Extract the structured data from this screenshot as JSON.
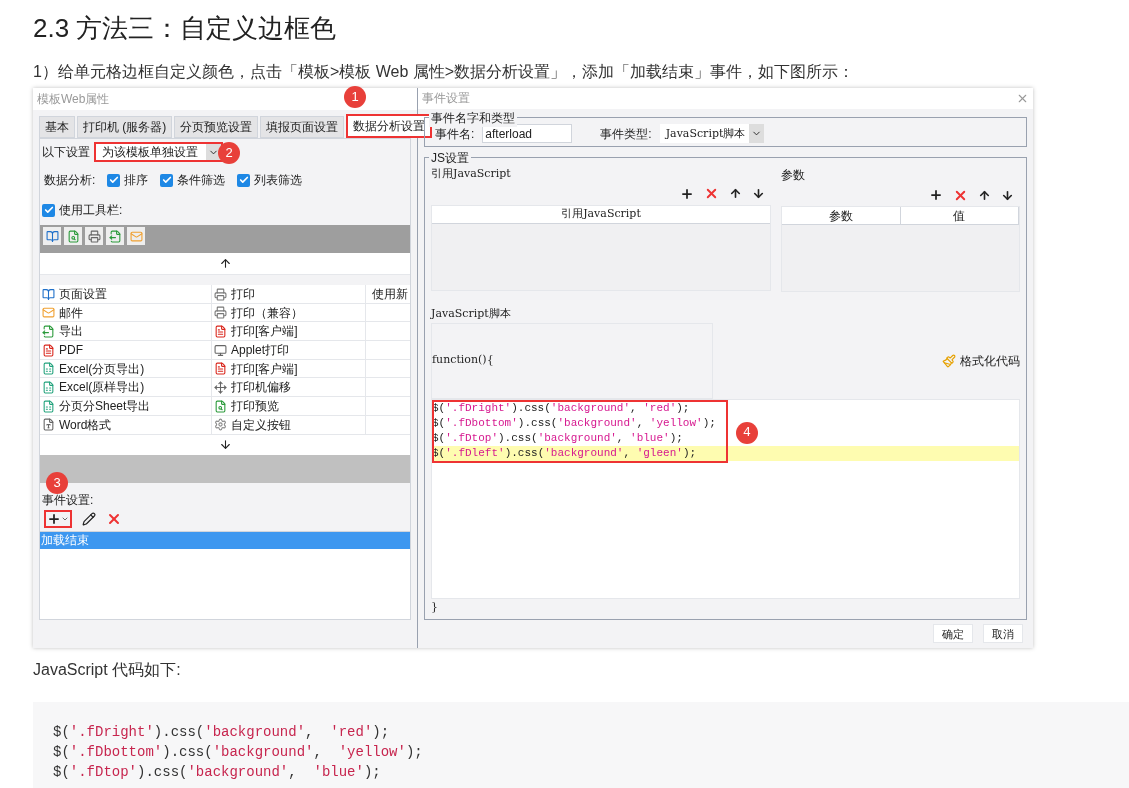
{
  "heading": "2.3 方法三：自定义边框色",
  "intro": "1）给单元格边框自定义颜色，点击「模板>模板 Web 属性>数据分析设置」，添加「加载结束」事件，如下图所示：",
  "web_dialog": {
    "title": "模板Web属性",
    "tabs": [
      {
        "label": "基本",
        "selected": false
      },
      {
        "label": "打印机 (服务器)",
        "selected": false
      },
      {
        "label": "分页预览设置",
        "selected": false
      },
      {
        "label": "填报页面设置",
        "selected": false
      },
      {
        "label": "数据分析设置",
        "selected": true
      }
    ],
    "tabs_callout": "1",
    "scope_label": "以下设置",
    "scope_value": "为该模板单独设置",
    "scope_callout": "2",
    "analysis_label": "数据分析:",
    "analysis_options": [
      {
        "label": "排序",
        "checked": true
      },
      {
        "label": "条件筛选",
        "checked": true
      },
      {
        "label": "列表筛选",
        "checked": true
      }
    ],
    "toolbar_option": {
      "label": "使用工具栏:",
      "checked": true
    },
    "button_rows": [
      [
        "页面设置",
        "打印",
        "使用新"
      ],
      [
        "邮件",
        "打印（兼容）"
      ],
      [
        "导出",
        "打印[客户端]"
      ],
      [
        "PDF",
        "Applet打印"
      ],
      [
        "Excel(分页导出)",
        "打印[客户端]"
      ],
      [
        "Excel(原样导出)",
        "打印机偏移"
      ],
      [
        "分页分Sheet导出",
        "打印预览"
      ],
      [
        "Word格式",
        "自定义按钮"
      ]
    ],
    "event_label": "事件设置:",
    "event_callout": "3",
    "events": [
      {
        "label": "加载结束",
        "selected": true
      }
    ]
  },
  "event_dialog": {
    "title": "事件设置",
    "name_group": "事件名字和类型",
    "name_label": "事件名:",
    "name_value": "afterload",
    "type_label": "事件类型:",
    "type_value": "JavaScript脚本",
    "js_group": "JS设置",
    "ref_label": "引用JavaScript",
    "ref_columns": [
      "引用JavaScript"
    ],
    "params_label": "参数",
    "params_columns": [
      "参数",
      "值"
    ],
    "script_label": "JavaScript脚本",
    "function_header": "function(){",
    "format_button": "格式化代码",
    "code_lines": [
      {
        "text": "$('.fDright').css('background', 'red');",
        "highlighted": false
      },
      {
        "text": "$('.fDbottom').css('background', 'yellow');",
        "highlighted": false
      },
      {
        "text": "$('.fDtop').css('background', 'blue');",
        "highlighted": false
      },
      {
        "text": "$('.fDleft').css('background', 'gleen');",
        "highlighted": true
      }
    ],
    "code_callout": "4",
    "closing": "}",
    "buttons": [
      "确定",
      "取消"
    ]
  },
  "code_intro": "JavaScript 代码如下:",
  "code_lines": [
    "$('.fDright').css('background',  'red');",
    "$('.fDbottom').css('background',  'yellow');",
    "$('.fDtop').css('background',  'blue');"
  ]
}
